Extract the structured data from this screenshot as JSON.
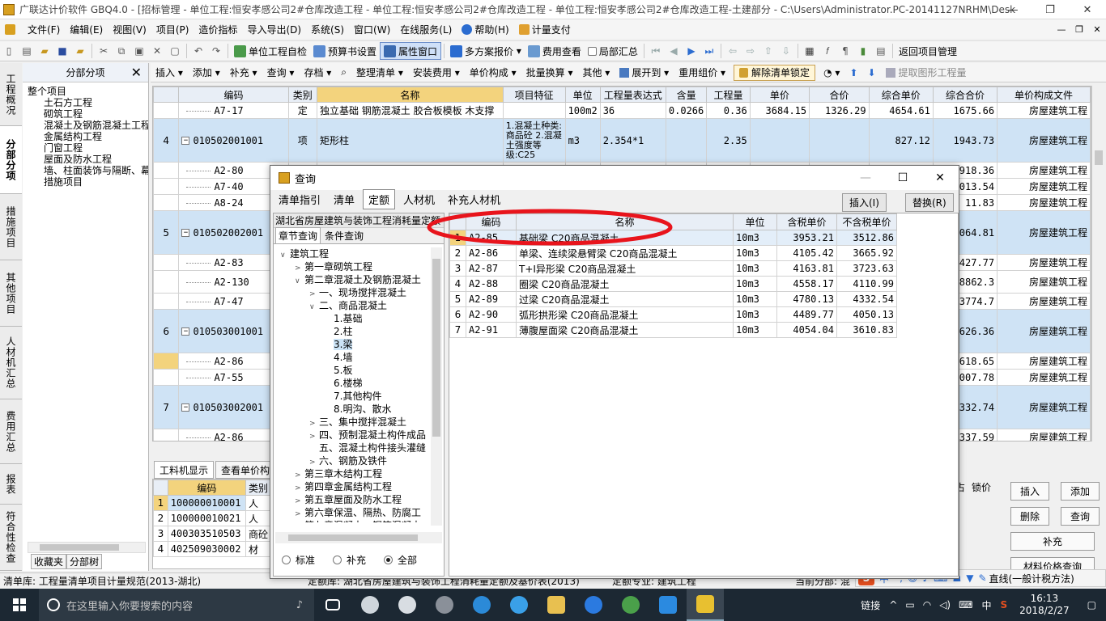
{
  "window": {
    "title": "广联达计价软件 GBQ4.0 - [招标管理 - 单位工程:恒安孝感公司2#仓库改造工程 - 单位工程:恒安孝感公司2#仓库改造工程 - 单位工程:恒安孝感公司2#仓库改造工程-土建部分 - C:\\Users\\Administrator.PC-20141127NRHM\\Desktop\\恒安孝感公..."
  },
  "menu": {
    "items": [
      "文件(F)",
      "编辑(E)",
      "视图(V)",
      "项目(P)",
      "造价指标",
      "导入导出(D)",
      "系统(S)",
      "窗口(W)",
      "在线服务(L)",
      "帮助(H)",
      "计量支付"
    ]
  },
  "toolbar": {
    "unit_check": "单位工程自检",
    "budget_settings": "预算书设置",
    "property_window": "属性窗口",
    "multi_quote": "多方案报价",
    "fee_view": "费用查看",
    "partial_summary": "局部汇总",
    "return_project": "返回项目管理"
  },
  "vtabs": [
    "工程概况",
    "分部分项",
    "措施项目",
    "其他项目",
    "人材机汇总",
    "费用汇总",
    "报表",
    "符合性检查"
  ],
  "tree_panel": {
    "header": "分部分项",
    "nodes": [
      {
        "label": "整个项目",
        "level": 0
      },
      {
        "label": "土石方工程",
        "level": 1
      },
      {
        "label": "砌筑工程",
        "level": 1
      },
      {
        "label": "混凝土及钢筋混凝土工程",
        "level": 1
      },
      {
        "label": "金属结构工程",
        "level": 1
      },
      {
        "label": "门窗工程",
        "level": 1
      },
      {
        "label": "屋面及防水工程",
        "level": 1
      },
      {
        "label": "墙、柱面装饰与隔断、幕墙工程",
        "level": 1
      },
      {
        "label": "措施项目",
        "level": 1
      }
    ],
    "bottom_tabs": [
      "收藏夹",
      "分部树"
    ]
  },
  "subbar": {
    "items": [
      "插入",
      "添加",
      "补充",
      "查询",
      "存档",
      "整理清单",
      "安装费用",
      "单价构成",
      "批量换算",
      "其他",
      "展开到",
      "重用组价"
    ],
    "unlock": "解除清单锁定",
    "extract": "提取图形工程量"
  },
  "main_grid": {
    "headers": [
      "编码",
      "类别",
      "名称",
      "项目特征",
      "单位",
      "工程量表达式",
      "含量",
      "工程量",
      "单价",
      "合价",
      "综合单价",
      "综合合价",
      "单价构成文件"
    ],
    "rows": [
      {
        "type": "sub",
        "no": "",
        "code": "A7-17",
        "cat": "定",
        "name": "独立基础 钢筋混凝土 胶合板模板 木支撑",
        "feature": "",
        "unit": "100m2",
        "expr": "36",
        "content": "0.0266",
        "qty": "0.36",
        "price": "3684.15",
        "total": "1326.29",
        "cprice": "4654.61",
        "ctotal": "1675.66",
        "file": "房屋建筑工程"
      },
      {
        "type": "item",
        "no": "4",
        "code": "010502001001",
        "cat": "项",
        "name": "矩形柱",
        "feature": "1.混凝土种类:商品砼 2.混凝土强度等级:C25",
        "unit": "m3",
        "expr": "2.354*1",
        "content": "",
        "qty": "2.35",
        "price": "",
        "total": "",
        "cprice": "827.12",
        "ctotal": "1943.73",
        "file": "房屋建筑工程"
      },
      {
        "type": "sub",
        "no": "",
        "code": "A2-80",
        "cat": "",
        "name": "",
        "feature": "",
        "unit": "",
        "expr": "",
        "content": "",
        "qty": "",
        "price": "",
        "total": "",
        "cprice": "",
        "ctotal": "918.36",
        "file": "房屋建筑工程"
      },
      {
        "type": "sub",
        "no": "",
        "code": "A7-40",
        "cat": "",
        "name": "",
        "feature": "",
        "unit": "",
        "expr": "",
        "content": "",
        "qty": "",
        "price": "",
        "total": "",
        "cprice": "",
        "ctotal": "013.54",
        "file": "房屋建筑工程"
      },
      {
        "type": "sub",
        "no": "",
        "code": "A8-24",
        "cat": "",
        "name": "",
        "feature": "",
        "unit": "",
        "expr": "",
        "content": "",
        "qty": "",
        "price": "",
        "total": "",
        "cprice": "",
        "ctotal": "11.83",
        "file": "房屋建筑工程"
      },
      {
        "type": "item",
        "no": "5",
        "code": "010502002001",
        "cat": "",
        "name": "",
        "feature": "",
        "unit": "",
        "expr": "",
        "content": "",
        "qty": "",
        "price": "",
        "total": "",
        "cprice": "",
        "ctotal": "064.81",
        "file": "房屋建筑工程"
      },
      {
        "type": "sub",
        "no": "",
        "code": "A2-83",
        "cat": "",
        "name": "",
        "feature": "",
        "unit": "",
        "expr": "",
        "content": "",
        "qty": "",
        "price": "",
        "total": "",
        "cprice": "",
        "ctotal": "427.77",
        "file": "房屋建筑工程"
      },
      {
        "type": "sub",
        "no": "",
        "code": "A2-130",
        "cat": "",
        "name": "",
        "feature": "",
        "unit": "",
        "expr": "",
        "content": "",
        "qty": "",
        "price": "",
        "total": "",
        "cprice": "",
        "ctotal": "8862.3",
        "file": "房屋建筑工程"
      },
      {
        "type": "sub",
        "no": "",
        "code": "A7-47",
        "cat": "",
        "name": "",
        "feature": "",
        "unit": "",
        "expr": "",
        "content": "",
        "qty": "",
        "price": "",
        "total": "",
        "cprice": "",
        "ctotal": "3774.7",
        "file": "房屋建筑工程"
      },
      {
        "type": "item",
        "no": "6",
        "code": "010503001001",
        "cat": "",
        "name": "",
        "feature": "",
        "unit": "",
        "expr": "",
        "content": "",
        "qty": "",
        "price": "",
        "total": "",
        "cprice": "",
        "ctotal": "626.36",
        "file": "房屋建筑工程"
      },
      {
        "type": "sub",
        "no": "",
        "code": "A2-86",
        "cat": "",
        "name": "",
        "feature": "",
        "unit": "",
        "expr": "",
        "content": "",
        "qty": "",
        "price": "",
        "total": "",
        "cprice": "",
        "ctotal": "618.65",
        "file": "房屋建筑工程"
      },
      {
        "type": "sub",
        "no": "",
        "code": "A7-55",
        "cat": "",
        "name": "",
        "feature": "",
        "unit": "",
        "expr": "",
        "content": "",
        "qty": "",
        "price": "",
        "total": "",
        "cprice": "",
        "ctotal": "007.78",
        "file": "房屋建筑工程"
      },
      {
        "type": "item",
        "no": "7",
        "code": "010503002001",
        "cat": "",
        "name": "",
        "feature": "",
        "unit": "",
        "expr": "",
        "content": "",
        "qty": "",
        "price": "",
        "total": "",
        "cprice": "",
        "ctotal": "332.74",
        "file": "房屋建筑工程"
      },
      {
        "type": "sub",
        "no": "",
        "code": "A2-86",
        "cat": "",
        "name": "",
        "feature": "",
        "unit": "",
        "expr": "",
        "content": "",
        "qty": "",
        "price": "",
        "total": "",
        "cprice": "",
        "ctotal": "337.59",
        "file": "房屋建筑工程"
      }
    ]
  },
  "bottom": {
    "tabs": [
      "工料机显示",
      "查看单价构"
    ],
    "headers": [
      "编码",
      "类别"
    ],
    "rows": [
      {
        "no": "1",
        "code": "100000010001",
        "cat": "人"
      },
      {
        "no": "2",
        "code": "100000010021",
        "cat": "人"
      },
      {
        "no": "3",
        "code": "400303510503",
        "cat": "商砼"
      },
      {
        "no": "4",
        "code": "402509030002",
        "cat": "材"
      }
    ],
    "right_headers": [
      "占",
      "锁价"
    ],
    "buttons": {
      "insert": "插入",
      "add": "添加",
      "delete": "删除",
      "query": "查询",
      "supplement": "补充",
      "price_query": "材料价格查询"
    }
  },
  "status": {
    "list_lib": "清单库: 工程量清单项目计量规范(2013-湖北)",
    "quota_lib": "定额库: 湖北省房屋建筑与装饰工程消耗量定额及基价表(2013)",
    "quota_major": "定额专业: 建筑工程",
    "current": "当前分部: 混"
  },
  "ime": {
    "tax": "直线(一般计税方法)"
  },
  "taskbar": {
    "search_placeholder": "在这里输入你要搜索的内容",
    "tray_text": "链接",
    "lang": "中",
    "time": "16:13",
    "date": "2018/2/27"
  },
  "dialog": {
    "title": "查询",
    "tabs": [
      "清单指引",
      "清单",
      "定额",
      "人材机",
      "补充人材机"
    ],
    "active_tab": 2,
    "insert_btn": "插入(I)",
    "replace_btn": "替换(R)",
    "library": "湖北省房屋建筑与装饰工程消耗量定额",
    "left_tabs": [
      "章节查询",
      "条件查询"
    ],
    "tree": [
      {
        "label": "建筑工程",
        "level": 0,
        "exp": "v"
      },
      {
        "label": "第一章砌筑工程",
        "level": 1,
        "exp": ">"
      },
      {
        "label": "第二章混凝土及钢筋混凝土",
        "level": 1,
        "exp": "v"
      },
      {
        "label": "一、现场搅拌混凝土",
        "level": 2,
        "exp": ">"
      },
      {
        "label": "二、商品混凝土",
        "level": 2,
        "exp": "v"
      },
      {
        "label": "1.基础",
        "level": 3,
        "exp": ""
      },
      {
        "label": "2.柱",
        "level": 3,
        "exp": ""
      },
      {
        "label": "3.梁",
        "level": 3,
        "exp": "",
        "hl": true
      },
      {
        "label": "4.墙",
        "level": 3,
        "exp": ""
      },
      {
        "label": "5.板",
        "level": 3,
        "exp": ""
      },
      {
        "label": "6.楼梯",
        "level": 3,
        "exp": ""
      },
      {
        "label": "7.其他构件",
        "level": 3,
        "exp": ""
      },
      {
        "label": "8.明沟、散水",
        "level": 3,
        "exp": ""
      },
      {
        "label": "三、集中搅拌混凝土",
        "level": 2,
        "exp": ">"
      },
      {
        "label": "四、预制混凝土构件成品",
        "level": 2,
        "exp": ">"
      },
      {
        "label": "五、混凝土构件接头灌缝",
        "level": 2,
        "exp": ""
      },
      {
        "label": "六、钢筋及铁件",
        "level": 2,
        "exp": ">"
      },
      {
        "label": "第三章木结构工程",
        "level": 1,
        "exp": ">"
      },
      {
        "label": "第四章金属结构工程",
        "level": 1,
        "exp": ">"
      },
      {
        "label": "第五章屋面及防水工程",
        "level": 1,
        "exp": ">"
      },
      {
        "label": "第六章保温、隔热、防腐工",
        "level": 1,
        "exp": ">"
      },
      {
        "label": "第七章混凝土、钢筋混凝土",
        "level": 1,
        "exp": ">"
      }
    ],
    "radios": [
      "标准",
      "补充",
      "全部"
    ],
    "radio_selected": 2,
    "grid_headers": [
      "编码",
      "名称",
      "单位",
      "含税单价",
      "不含税单价"
    ],
    "rows": [
      {
        "no": "1",
        "code": "A2-85",
        "name": "基础梁 C20商品混凝土",
        "unit": "10m3",
        "price_tax": "3953.21",
        "price_notax": "3512.86"
      },
      {
        "no": "2",
        "code": "A2-86",
        "name": "单梁、连续梁悬臂梁 C20商品混凝土",
        "unit": "10m3",
        "price_tax": "4105.42",
        "price_notax": "3665.92"
      },
      {
        "no": "3",
        "code": "A2-87",
        "name": "T+I异形梁 C20商品混凝土",
        "unit": "10m3",
        "price_tax": "4163.81",
        "price_notax": "3723.63"
      },
      {
        "no": "4",
        "code": "A2-88",
        "name": "圈梁 C20商品混凝土",
        "unit": "10m3",
        "price_tax": "4558.17",
        "price_notax": "4110.99"
      },
      {
        "no": "5",
        "code": "A2-89",
        "name": "过梁 C20商品混凝土",
        "unit": "10m3",
        "price_tax": "4780.13",
        "price_notax": "4332.54"
      },
      {
        "no": "6",
        "code": "A2-90",
        "name": "弧形拱形梁 C20商品混凝土",
        "unit": "10m3",
        "price_tax": "4489.77",
        "price_notax": "4050.13"
      },
      {
        "no": "7",
        "code": "A2-91",
        "name": "薄腹屋面梁 C20商品混凝土",
        "unit": "10m3",
        "price_tax": "4054.04",
        "price_notax": "3610.83"
      }
    ]
  },
  "colors": {
    "highlight_header": "#f3d37d",
    "item_row": "#cfe3f5",
    "annotation_ellipse": "#e8141c"
  }
}
